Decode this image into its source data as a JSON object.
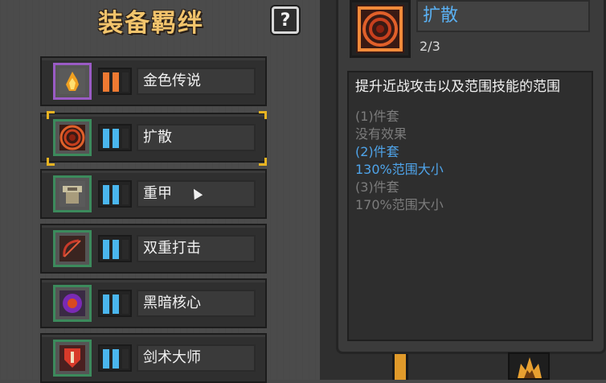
{
  "title": "装备羁绊",
  "help_label": "?",
  "sets": [
    {
      "name": "金色传说",
      "icon": "golden-flame-icon",
      "frame": "purple",
      "bar_color": "orange"
    },
    {
      "name": "扩散",
      "icon": "spread-rings-icon",
      "frame": "green",
      "bar_color": "blue",
      "selected": true
    },
    {
      "name": "重甲",
      "icon": "heavy-armor-icon",
      "frame": "green",
      "bar_color": "blue"
    },
    {
      "name": "双重打击",
      "icon": "double-strike-bow-icon",
      "frame": "green",
      "bar_color": "blue"
    },
    {
      "name": "黑暗核心",
      "icon": "dark-core-icon",
      "frame": "green",
      "bar_color": "blue"
    },
    {
      "name": "剑术大师",
      "icon": "sword-master-shield-icon",
      "frame": "green",
      "bar_color": "blue"
    }
  ],
  "detail": {
    "title": "扩散",
    "count": "2/3",
    "description": "提升近战攻击以及范围技能的范围",
    "tiers": [
      {
        "label": "(1)件套",
        "effect": "没有效果",
        "active": false
      },
      {
        "label": "(2)件套",
        "effect": "130%范围大小",
        "active": true
      },
      {
        "label": "(3)件套",
        "effect": "170%范围大小",
        "active": false
      }
    ]
  },
  "colors": {
    "title_gold": "#f2c46c",
    "active_blue": "#4fa4ea",
    "inactive_gray": "#7c7c7c",
    "selected_gold": "#e8b422"
  }
}
